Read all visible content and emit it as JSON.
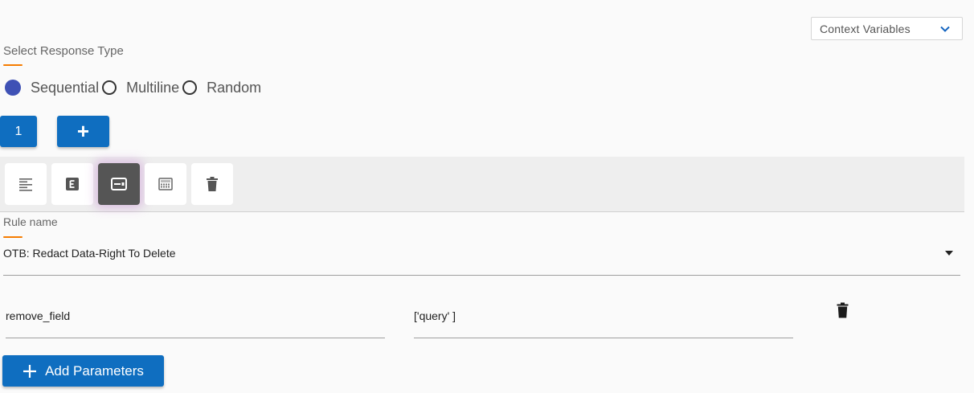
{
  "context_variables": {
    "label": "Context Variables"
  },
  "response_type": {
    "caption": "Select Response Type",
    "options": [
      "Sequential",
      "Multiline",
      "Random"
    ],
    "selected": "Sequential"
  },
  "responses": {
    "index_label": "1",
    "add_label": "+"
  },
  "toolbar": {
    "tools": [
      "text-format-icon",
      "e-block-icon",
      "card-icon",
      "grid-pattern-icon",
      "trash-icon"
    ],
    "active": "card-icon"
  },
  "rule": {
    "caption": "Rule name",
    "value": "OTB: Redact Data-Right To Delete"
  },
  "parameters": [
    {
      "name": "remove_field",
      "value": "['query' ]"
    }
  ],
  "add_parameters_label": "Add Parameters",
  "colors": {
    "primary": "#0f6ec0",
    "accent": "#f57c00",
    "radio": "#3f51b5"
  }
}
